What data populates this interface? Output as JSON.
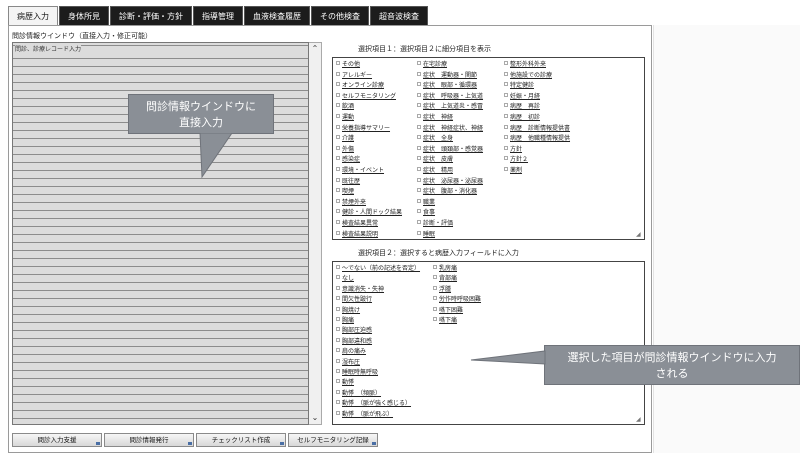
{
  "tabs": [
    "病歴入力",
    "身体所見",
    "診断・評価・方針",
    "指導管理",
    "血液検査履歴",
    "その他検査",
    "超音波検査"
  ],
  "left_section_title": "問診情報ウインドウ（直接入力・修正可能）",
  "left_window_header": "問診、診療レコード入力",
  "callout_left": [
    "問診情報ウインドウに",
    "直接入力"
  ],
  "callout_right": [
    "選択した項目が問診情報ウインドウに入力",
    "される"
  ],
  "sel1_title": "選択項目１：選択項目２に細分項目を表示",
  "sel1_col1": [
    "その他",
    "アレルギー",
    "オンライン診療",
    "セルフモニタリング",
    "飲酒",
    "運動",
    "栄養指導サマリー",
    "介護",
    "外傷",
    "感染症",
    "環境・イベント",
    "既往歴",
    "喫煙",
    "禁煙外来",
    "健診・人間ドック結果",
    "検査結果異常",
    "検査結果説明"
  ],
  "sel1_col2": [
    "在宅診療",
    "症状　運動器・関節",
    "症状　眼部・循環器",
    "症状　呼吸器・上気道",
    "症状　上気道炎・感冒",
    "症状　神経",
    "症状　神経症状、神経",
    "症状　全身",
    "症状　頭頚部・感覚器",
    "症状　皮膚",
    "症状　精用",
    "症状　泌尿器・泌尿器",
    "症状　腹部・消化器",
    "職業",
    "食事",
    "診断・評価",
    "睡眠"
  ],
  "sel1_col3": [
    "整形外科外来",
    "他施設での診療",
    "特定健診",
    "妊娠・月経",
    "病歴　再診",
    "病歴　初診",
    "病歴　診断情報提供書",
    "病歴　他職種情報提供",
    "方針",
    "方針２",
    "薬剤"
  ],
  "sel2_title": "選択項目２：選択すると病歴入力フィールドに入力",
  "sel2_col1": [
    "～でない（前の記述を否定）",
    "なし",
    "意識消失・失神",
    "間欠性跛行",
    "胸焼け",
    "胸痛",
    "胸部圧迫感",
    "胸部違和感",
    "肩の痛み",
    "湿布圧",
    "睡眠時無呼吸",
    "動悸",
    "動悸　（頻脈）",
    "動悸　（脈が強く感じる）",
    "動悸　（脈が飛ぶ）"
  ],
  "sel2_col2": [
    "乳房痛",
    "背部痛",
    "浮腫",
    "労作時呼吸困難",
    "嚥下困難",
    "嚥下痛"
  ],
  "buttons": [
    "問診入力支援",
    "問診情報発行",
    "チェックリスト作成",
    "セルフモニタリング記録"
  ],
  "colors": {
    "tab_bg": "#1c1c1c",
    "callout_bg": "#8a8f96",
    "lined_bg": "#dcdcdc"
  }
}
